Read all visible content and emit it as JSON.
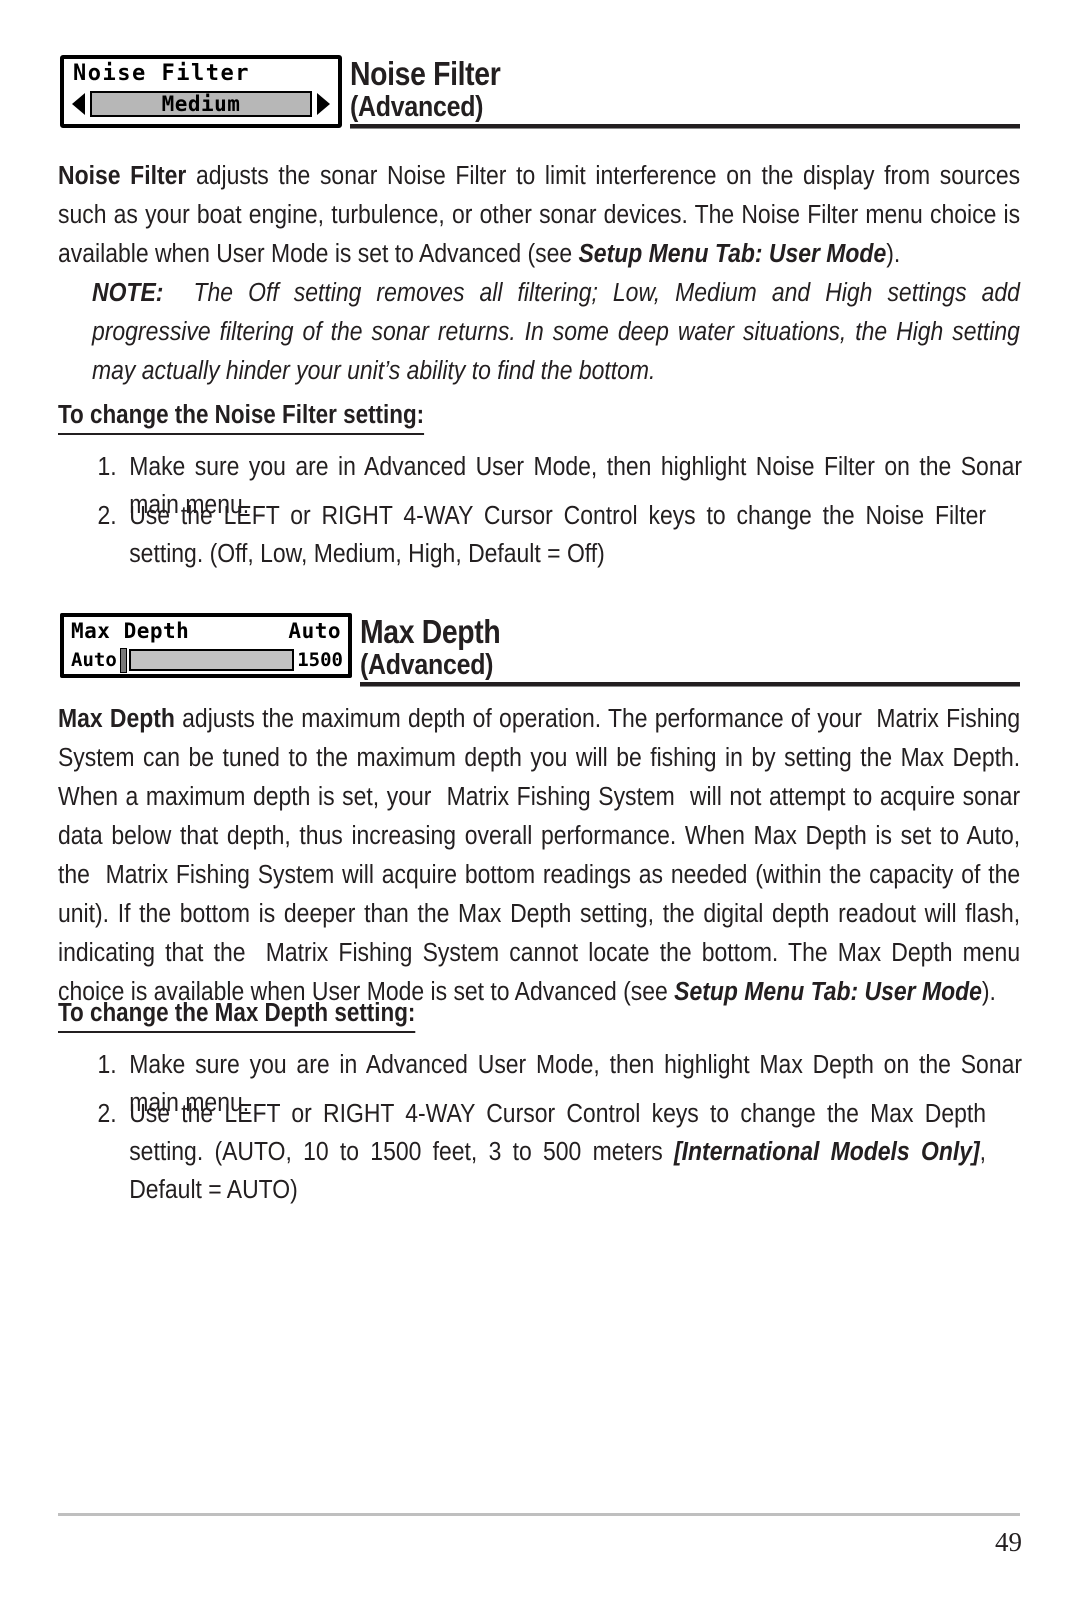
{
  "page": {
    "number": "49"
  },
  "sections": [
    {
      "id": "noise-filter",
      "title": "Noise Filter",
      "subtitle": "(Advanced)",
      "widget": {
        "type": "option-selector",
        "label": "Noise Filter",
        "value": "Medium",
        "left_arrow": "left-arrow-icon",
        "right_arrow": "right-arrow-icon"
      },
      "paragraph_html": "<b>Noise Filter</b> adjusts the sonar Noise Filter to limit interference on the display from sources such as your boat engine, turbulence, or other sonar devices. The Noise Filter menu choice is available when User Mode is set to Advanced (see <span class=\"bi\">Setup Menu Tab: User Mode</span>).",
      "note_html": "<b>NOTE:</b>&nbsp; The Off setting removes all filtering; Low, Medium and High settings add progressive filtering of the sonar returns. In some deep water situations, the High setting may actually hinder your unit’s ability to find the bottom.",
      "sub_head": "To change the Noise Filter setting:",
      "steps": [
        {
          "num": "1.",
          "text_html": "Make sure you are in Advanced User Mode, then highlight Noise Filter on the Sonar main menu."
        },
        {
          "num": "2.",
          "text_html": "Use the LEFT or RIGHT 4-WAY Cursor Control keys to change the Noise Filter setting. (Off, Low, Medium, High, Default = Off)"
        }
      ]
    },
    {
      "id": "max-depth",
      "title": "Max Depth",
      "subtitle": "(Advanced)",
      "widget": {
        "type": "slider",
        "label": "Max Depth",
        "value": "Auto",
        "min_label": "Auto",
        "max_label": "1500"
      },
      "paragraph_html": "<b>Max Depth</b> adjusts the maximum depth of operation. The performance of your&nbsp; Matrix Fishing System can be tuned to the maximum depth you will be fishing in by setting the Max Depth. When a maximum depth is set, your&nbsp; Matrix Fishing System&nbsp; will not attempt to acquire sonar data below that depth, thus increasing overall performance. When Max Depth is set to Auto, the&nbsp; Matrix Fishing System will acquire bottom readings as needed (within the capacity of the unit). If the bottom is deeper than the Max Depth setting, the digital depth readout will flash, indicating that the&nbsp; Matrix Fishing System cannot locate the bottom. The Max Depth menu choice is available when User Mode is set to Advanced (see <span class=\"bi\">Setup Menu Tab: User Mode</span>).",
      "sub_head": "To change the Max Depth setting:",
      "steps": [
        {
          "num": "1.",
          "text_html": "Make sure you are in Advanced User Mode, then highlight Max Depth on the Sonar main menu."
        },
        {
          "num": "2.",
          "text_html": "Use the LEFT or RIGHT 4-WAY Cursor Control keys to change the Max Depth setting. (AUTO, 10 to 1500 feet, 3 to 500 meters <span class=\"bi\">[International Models Only]</span>, Default = AUTO)"
        }
      ]
    }
  ],
  "colors": {
    "ink": "#231f20",
    "lcd_bar": "#b7b7b7",
    "lcd_track": "#c2c2c2",
    "footer_rule": "#bfbfbf"
  }
}
